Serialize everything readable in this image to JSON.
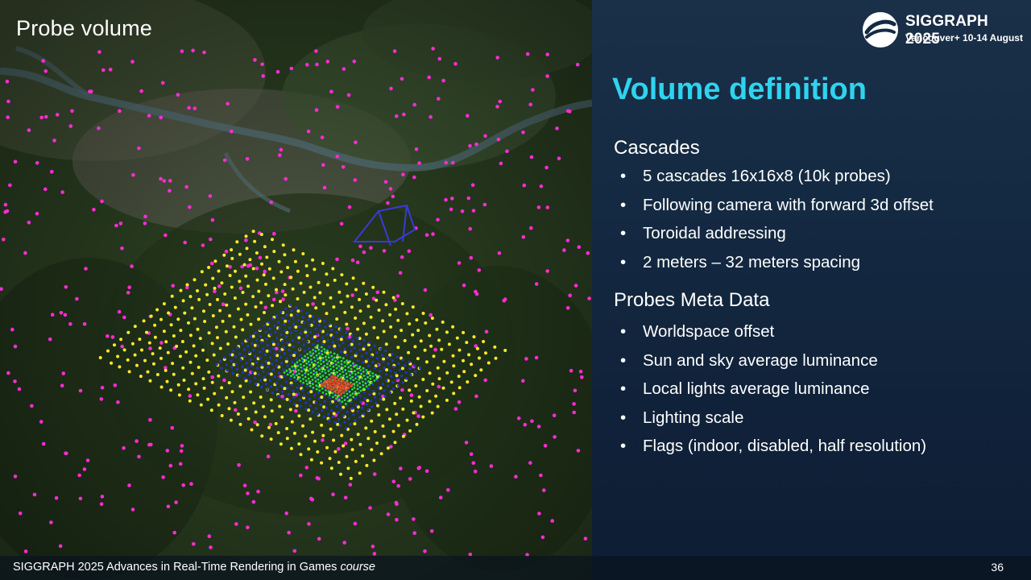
{
  "slide": {
    "title": "Probe volume",
    "heading": "Volume definition",
    "page_number": "36"
  },
  "logo": {
    "name": "SIGGRAPH 2025",
    "subtitle": "Vancouver+ 10-14 August"
  },
  "sections": [
    {
      "title": "Cascades",
      "bullets": [
        "5 cascades 16x16x8 (10k probes)",
        "Following camera with forward 3d offset",
        "Toroidal addressing",
        "2 meters – 32 meters spacing"
      ]
    },
    {
      "title": "Probes Meta Data",
      "bullets": [
        "Worldspace offset",
        "Sun and sky average luminance",
        "Local lights average luminance",
        "Lighting scale",
        "Flags (indoor, disabled, half resolution)"
      ]
    }
  ],
  "footer": {
    "text": "SIGGRAPH 2025 Advances in Real-Time Rendering in Games",
    "emphasis": "course"
  },
  "colors": {
    "heading": "#2fd3ee",
    "probe_cascade_far": "#ff2bd6",
    "probe_cascade_mid": "#ffea2a",
    "probe_cascade_near": "#2233cc",
    "probe_cascade_nearer": "#22e03a",
    "probe_cascade_nearest": "#e8422a"
  }
}
